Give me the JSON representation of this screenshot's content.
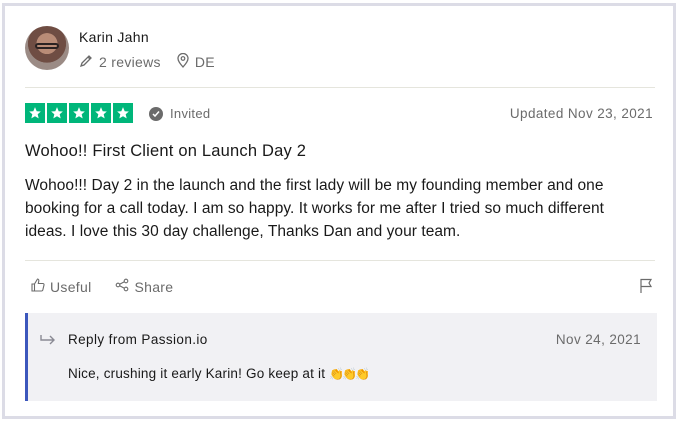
{
  "reviewer": {
    "name": "Karin Jahn",
    "reviews_count": "2 reviews",
    "country": "DE"
  },
  "rating": {
    "stars": 5,
    "max_stars": 5,
    "star_color": "#00b67a",
    "invited_label": "Invited",
    "updated_label": "Updated Nov 23, 2021"
  },
  "review": {
    "title": "Wohoo!! First Client on Launch Day 2",
    "body": "Wohoo!!! Day 2 in the launch and the first lady will be my founding member and one booking for a call today. I am so happy. It works for me after I tried so much different ideas. I love this 30 day challenge, Thanks Dan and your team."
  },
  "actions": {
    "useful_label": "Useful",
    "share_label": "Share"
  },
  "reply": {
    "from_label": "Reply from Passion.io",
    "date": "Nov 24, 2021",
    "text": "Nice, crushing it early Karin! Go keep at it",
    "emoji": "👏👏👏",
    "accent_color": "#3c57bc"
  }
}
